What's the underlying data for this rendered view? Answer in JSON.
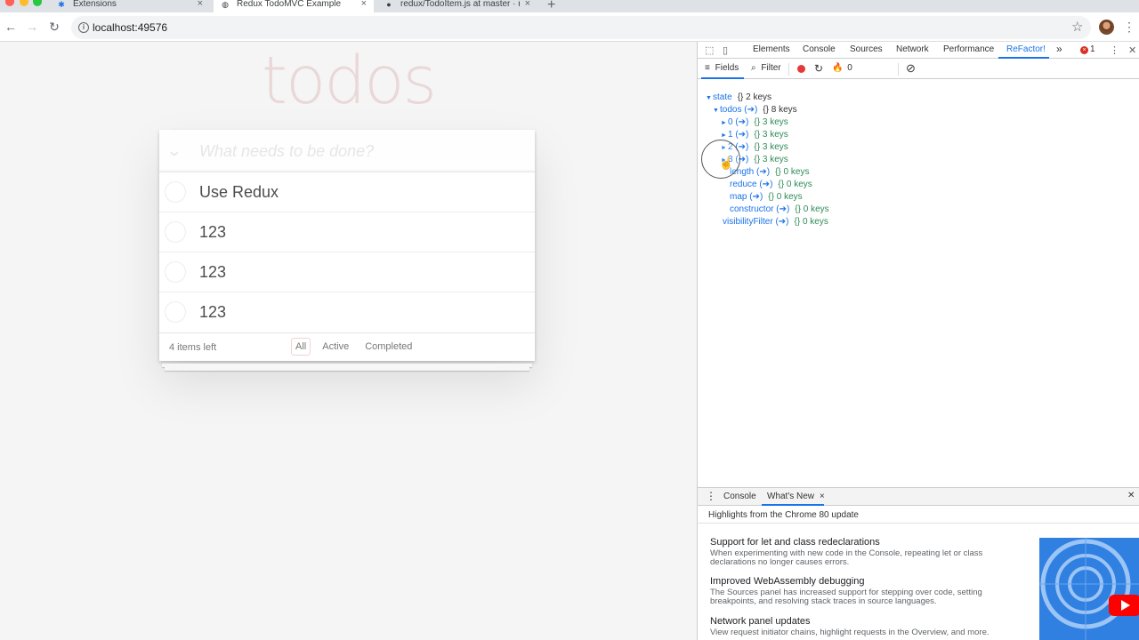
{
  "browser": {
    "tabs": [
      {
        "title": "Extensions",
        "icon": "puzzle-icon"
      },
      {
        "title": "Redux TodoMVC Example",
        "icon": "globe-icon",
        "active": true
      },
      {
        "title": "redux/TodoItem.js at master · r",
        "icon": "github-icon"
      }
    ],
    "url": "localhost:49576"
  },
  "todo": {
    "title": "todos",
    "placeholder": "What needs to be done?",
    "items": [
      "Use Redux",
      "123",
      "123",
      "123"
    ],
    "count": "4 items left",
    "filters": [
      "All",
      "Active",
      "Completed"
    ],
    "selected_filter": "All"
  },
  "devtools": {
    "tabs": [
      "Elements",
      "Console",
      "Sources",
      "Network",
      "Performance",
      "ReFactor!"
    ],
    "active_tab": "ReFactor!",
    "more": "»",
    "error_count": "1",
    "refactor_toolbar": {
      "fields": "Fields",
      "filter": "Filter",
      "fire_count": "0"
    },
    "tree": [
      {
        "key": "state",
        "meta": "{}  2 keys",
        "arrow": "▼",
        "meta_dark": true
      },
      {
        "key": "todos (➔)",
        "meta": "{}  8 keys",
        "arrow": "▼",
        "meta_dark": true
      },
      {
        "key": "0 (➔)",
        "meta": "{}  3 keys",
        "arrow": "►"
      },
      {
        "key": "1 (➔)",
        "meta": "{}  3 keys",
        "arrow": "►"
      },
      {
        "key": "2 (➔)",
        "meta": "{}  3 keys",
        "arrow": "►"
      },
      {
        "key": "3 (➔)",
        "meta": "{}  3 keys",
        "arrow": "►"
      },
      {
        "key": "length (➔)",
        "meta": "{}  0 keys",
        "arrow": ""
      },
      {
        "key": "reduce (➔)",
        "meta": "{}  0 keys",
        "arrow": ""
      },
      {
        "key": "map (➔)",
        "meta": "{}  0 keys",
        "arrow": ""
      },
      {
        "key": "constructor (➔)",
        "meta": "{}  0 keys",
        "arrow": ""
      },
      {
        "key": "visibilityFilter (➔)",
        "meta": "{}  0 keys",
        "arrow": ""
      }
    ],
    "drawer": {
      "tabs": [
        "Console",
        "What's New"
      ],
      "active_tab": "What's New",
      "headline": "Highlights from the Chrome 80 update",
      "news": [
        {
          "title": "Support for let and class redeclarations",
          "desc": "When experimenting with new code in the Console, repeating let or class declarations no longer causes errors."
        },
        {
          "title": "Improved WebAssembly debugging",
          "desc": "The Sources panel has increased support for stepping over code, setting breakpoints, and resolving stack traces in source languages."
        },
        {
          "title": "Network panel updates",
          "desc": "View request initiator chains, highlight requests in the Overview, and more."
        }
      ]
    }
  }
}
